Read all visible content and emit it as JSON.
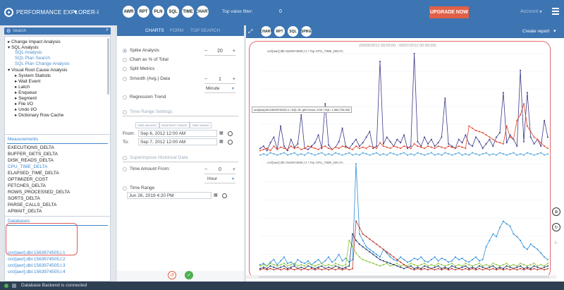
{
  "app": {
    "title": "PERFORMANCE EXPLORER-I"
  },
  "toolbar": {
    "icons": [
      "AWR",
      "RPT",
      "PLN",
      "SQL",
      "TIME",
      "CHART"
    ],
    "top_value_filter_label": "Top value filter:",
    "top_value_filter_value": "0",
    "upgrade_label": "UPGRADE NOW",
    "account_label": "Account"
  },
  "sidebar": {
    "search_placeholder": "Search",
    "tree": [
      {
        "label": "Change Impact Analysis"
      },
      {
        "label": "SQL Analysis"
      },
      {
        "label": "SQL Analysis"
      },
      {
        "label": "SQL Plan Search"
      },
      {
        "label": "SQL Plan Change Analysis"
      },
      {
        "label": "Visual Root Cause Analysis"
      },
      {
        "label": "System Statistic"
      },
      {
        "label": "Wait Event"
      },
      {
        "label": "Latch"
      },
      {
        "label": "Enqueue"
      },
      {
        "label": "Segment"
      },
      {
        "label": "File I/O"
      },
      {
        "label": "Undo I/O"
      },
      {
        "label": "Dictionary Row Cache"
      }
    ],
    "measurements_title": "Measurements",
    "measurements": [
      "EXECUTIONS_DELTA",
      "BUFFER_GETS_DELTA",
      "DISK_READS_DELTA",
      "CPU_TIME_DELTA",
      "ELAPSED_TIME_DELTA",
      "OPTIMIZER_COST",
      "FETCHES_DELTA",
      "ROWS_PROCESSED_DELTA",
      "SORTS_DELTA",
      "PARSE_CALLS_DELTA",
      "APWAIT_DELTA"
    ],
    "databases_title": "Databases",
    "databases": [
      "orcl[awr];dbi:1563974505;i:1",
      "orcl[awr];dbi:1563974505;i:2",
      "orcl[awr];dbi:1563974505;i:3",
      "orcl[awr];dbi:1563974505;i:4"
    ]
  },
  "tabs": [
    "CHARTS",
    "FORM",
    "TOP SEARCH"
  ],
  "form": {
    "spike_analysis": "Spike Analysis",
    "spike_value": "20",
    "chart_pct": "Chart as % of Total",
    "split_metrics": "Split Metrics",
    "smooth": "Smooth (Avg.) Data",
    "smooth_value": "1",
    "smooth_unit": "Minute",
    "regression": "Regression Trend",
    "time_range_settings": "Time Range Settings",
    "seg_tabs": [
      "TIME AMOUNT",
      "SNAPSHOT RANGE",
      "TIME RANGE"
    ],
    "from_label": "From:",
    "from_value": "Sep 6, 2012 12:00 AM",
    "to_label": "To:",
    "to_value": "Sep 7, 2012 12:00 AM",
    "superimpose": "Superimpose Historical Data",
    "time_amount_from": "Time Amount From:",
    "time_amount_value": "0",
    "time_amount_unit": "Hour",
    "time_range": "Time Range",
    "time_range_value": "Jun 26, 2019 4:20 PM"
  },
  "chart_area": {
    "create_report": "Create report",
    "icons": [
      "CHART",
      "RPT",
      "SQL",
      "SPIKE"
    ],
    "date_range": "(09/06/2012 00:00:00 - 09/07/2012 00:00:00)",
    "tooltip": "orcl[awr];dbi:1563974505;i:1 / SQL ID: g5x7ncmz; 3:00 / SQL: 1,984,726,000"
  },
  "chart_data": [
    {
      "type": "line",
      "title": "orcl[awr];dbi:1563974505;i:1 / Top CPU_TIME_DELTA",
      "ylabel": "",
      "xlabel": "",
      "series": [
        {
          "color": "#3b3a8c",
          "values": [
            10,
            12,
            8,
            15,
            20,
            9,
            30,
            12,
            8,
            18,
            11,
            14,
            40,
            10,
            9,
            12,
            15,
            22,
            10,
            50,
            13,
            9,
            11,
            16,
            28,
            12,
            10,
            14,
            18,
            12,
            15,
            20,
            25,
            10,
            12,
            88,
            14,
            20,
            16,
            12,
            18,
            15,
            22,
            10,
            12,
            95,
            16,
            12,
            20,
            14,
            18,
            12,
            15,
            20,
            55,
            14,
            12,
            10,
            18,
            15,
            22,
            14,
            12,
            20,
            16,
            10,
            14,
            18,
            12,
            20,
            24,
            60,
            15,
            22,
            18,
            12,
            80,
            16,
            60,
            20,
            14,
            18,
            12,
            35,
            20
          ]
        },
        {
          "color": "#e0442a",
          "values": [
            8,
            9,
            10,
            8,
            12,
            9,
            11,
            10,
            9,
            12,
            10,
            11,
            9,
            10,
            12,
            11,
            10,
            9,
            11,
            12,
            10,
            9,
            11,
            10,
            12,
            11,
            10,
            9,
            12,
            10,
            11,
            10,
            12,
            11,
            10,
            15,
            12,
            11,
            10,
            12,
            11,
            10,
            12,
            11,
            10,
            14,
            12,
            11,
            10,
            12,
            11,
            10,
            12,
            11,
            10,
            12,
            11,
            10,
            12,
            11,
            10,
            30,
            28,
            26,
            25,
            24,
            22,
            20,
            18,
            16,
            15,
            14,
            30,
            20,
            18,
            35,
            40,
            50,
            30,
            25,
            20,
            18,
            15,
            12,
            10
          ]
        },
        {
          "color": "#4aa3df",
          "values": [
            4,
            5,
            4,
            6,
            5,
            4,
            5,
            6,
            4,
            5,
            6,
            4,
            5,
            4,
            6,
            5,
            4,
            5,
            6,
            4,
            5,
            4,
            6,
            5,
            4,
            5,
            6,
            4,
            5,
            4,
            6,
            5,
            4,
            5,
            6,
            4,
            5,
            4,
            6,
            5,
            4,
            5,
            6,
            4,
            5,
            4,
            6,
            5,
            4,
            5,
            6,
            4,
            5,
            4,
            6,
            5,
            4,
            5,
            6,
            4,
            5,
            4,
            6,
            5,
            4,
            5,
            6,
            4,
            5,
            4,
            6,
            5,
            4,
            5,
            6,
            4,
            5,
            4,
            6,
            5,
            4,
            5,
            6,
            4,
            5
          ]
        }
      ]
    },
    {
      "type": "line",
      "title": "orcl[awr];dbi:1563974505;i:2 / Top CPU_TIME_DELTA",
      "ylabel": "",
      "xlabel": "",
      "series": [
        {
          "color": "#2f8fd8",
          "values": [
            6,
            7,
            5,
            8,
            10,
            6,
            9,
            12,
            7,
            8,
            6,
            10,
            8,
            7,
            9,
            6,
            8,
            10,
            7,
            9,
            12,
            8,
            10,
            14,
            9,
            11,
            8,
            10,
            85,
            30,
            25,
            20,
            18,
            16,
            14,
            12,
            18,
            15,
            12,
            10,
            9,
            12,
            10,
            8,
            9,
            11,
            10,
            12,
            9,
            8,
            10,
            12,
            9,
            11,
            10,
            8,
            9,
            12,
            10,
            11,
            9,
            8,
            10,
            12,
            9,
            10,
            20,
            25,
            30,
            28,
            35,
            40,
            38,
            36,
            30,
            28,
            25,
            20,
            18,
            22,
            20,
            18,
            15,
            12,
            10
          ]
        },
        {
          "color": "#8dc63f",
          "values": [
            5,
            6,
            5,
            7,
            6,
            5,
            6,
            7,
            5,
            6,
            7,
            5,
            6,
            5,
            7,
            6,
            5,
            6,
            7,
            5,
            6,
            5,
            7,
            6,
            5,
            6,
            25,
            20,
            15,
            12,
            10,
            9,
            8,
            7,
            6,
            5,
            6,
            7,
            5,
            6,
            7,
            5,
            6,
            5,
            7,
            6,
            5,
            6,
            7,
            5,
            6,
            5,
            7,
            6,
            5,
            6,
            7,
            5,
            6,
            5,
            7,
            6,
            5,
            6,
            7,
            5,
            6,
            5,
            7,
            6,
            5,
            6,
            7,
            5,
            6,
            5,
            7,
            6,
            5,
            6,
            7,
            5,
            6,
            5,
            7
          ]
        },
        {
          "color": "#1f3b6e",
          "values": [
            3,
            4,
            3,
            5,
            4,
            3,
            4,
            5,
            3,
            4,
            5,
            3,
            4,
            3,
            5,
            4,
            3,
            4,
            5,
            3,
            4,
            3,
            5,
            4,
            3,
            4,
            5,
            30,
            25,
            22,
            20,
            18,
            16,
            14,
            12,
            10,
            9,
            8,
            7,
            6,
            5,
            4,
            3,
            4,
            5,
            3,
            4,
            3,
            5,
            4,
            3,
            4,
            5,
            3,
            4,
            3,
            5,
            4,
            3,
            4,
            5,
            3,
            4,
            3,
            5,
            4,
            3,
            4,
            5,
            3,
            4,
            3,
            5,
            4,
            3,
            4,
            5,
            3,
            4,
            3,
            5,
            4,
            3,
            4,
            5
          ]
        },
        {
          "color": "#c0392b",
          "values": [
            2,
            3,
            2,
            3,
            2,
            3,
            2,
            3,
            2,
            3,
            2,
            3,
            2,
            3,
            2,
            3,
            2,
            3,
            2,
            3,
            2,
            3,
            2,
            3,
            2,
            3,
            2,
            3,
            40,
            35,
            30,
            28,
            26,
            24,
            22,
            20,
            18,
            16,
            14,
            12,
            10,
            8,
            6,
            4,
            3,
            2,
            3,
            2,
            3,
            2,
            3,
            2,
            3,
            2,
            3,
            2,
            3,
            2,
            3,
            2,
            3,
            2,
            3,
            2,
            3,
            2,
            3,
            2,
            3,
            2,
            3,
            2,
            3,
            2,
            3,
            2,
            3,
            2,
            3,
            2,
            3,
            2,
            3,
            2,
            3
          ]
        }
      ]
    }
  ],
  "status": {
    "text": "Database Backend is connected"
  }
}
